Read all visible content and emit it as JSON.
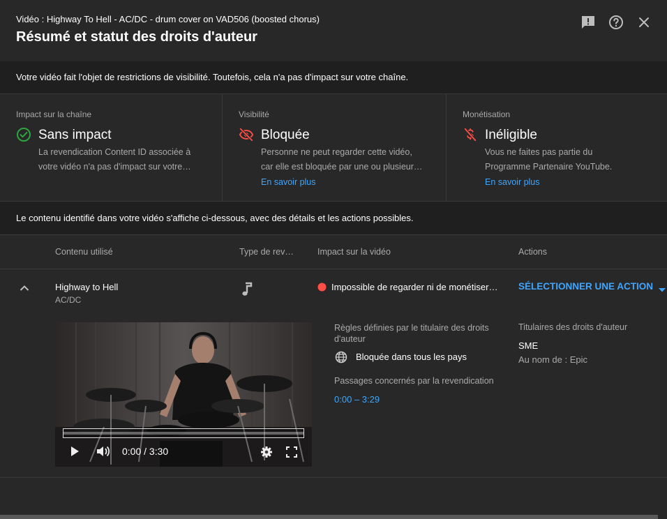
{
  "header": {
    "subtitle": "Vidéo : Highway To Hell - AC/DC - drum cover on VAD506 (boosted chorus)",
    "title": "Résumé et statut des droits d'auteur"
  },
  "notice": "Votre vidéo fait l'objet de restrictions de visibilité. Toutefois, cela n'a pas d'impact sur votre chaîne.",
  "status": {
    "channel": {
      "label": "Impact sur la chaîne",
      "value": "Sans impact",
      "desc_line1": "La revendication Content ID associée à",
      "desc_line2": "votre vidéo n'a pas d'impact sur votre…"
    },
    "visibility": {
      "label": "Visibilité",
      "value": "Bloquée",
      "desc_line1": "Personne ne peut regarder cette vidéo,",
      "desc_line2": "car elle est bloquée par une ou plusieur…",
      "link": "En savoir plus"
    },
    "monetization": {
      "label": "Monétisation",
      "value": "Inéligible",
      "desc_line1": "Vous ne faites pas partie du",
      "desc_line2": "Programme Partenaire YouTube.",
      "link": "En savoir plus"
    }
  },
  "info": "Le contenu identifié dans votre vidéo s'affiche ci-dessous, avec des détails et les actions possibles.",
  "table": {
    "headers": [
      "Contenu utilisé",
      "Type de reve…",
      "Impact sur la vidéo",
      "Actions"
    ]
  },
  "claim": {
    "song": "Highway to Hell",
    "artist": "AC/DC",
    "impact": "Impossible de regarder ni de monétiser…",
    "action": "SÉLECTIONNER UNE ACTION",
    "rules_label_line1": "Règles définies par le titulaire des droits",
    "rules_label_line2": "d'auteur",
    "rule": "Bloquée dans tous les pays",
    "segments_label": "Passages concernés par la revendication",
    "segment": "0:00 – 3:29",
    "owners_label": "Titulaires des droits d'auteur",
    "owner": "SME",
    "owner_on_behalf": "Au nom de : Epic"
  },
  "player": {
    "time": "0:00 / 3:30",
    "progress": 0
  },
  "colors": {
    "background": "#282828",
    "band": "#1f1f1f",
    "link": "#3ea6ff",
    "success": "#2ba640",
    "error": "#ff4e45",
    "text_secondary": "#aaaaaa"
  },
  "icons": [
    "feedback-icon",
    "help-icon",
    "close-icon",
    "check-circle-icon",
    "visibility-off-icon",
    "money-off-icon",
    "chevron-up-icon",
    "music-note-icon",
    "error-dot-icon",
    "dropdown-arrow-icon",
    "globe-icon",
    "play-icon",
    "volume-icon",
    "settings-icon",
    "fullscreen-icon"
  ]
}
